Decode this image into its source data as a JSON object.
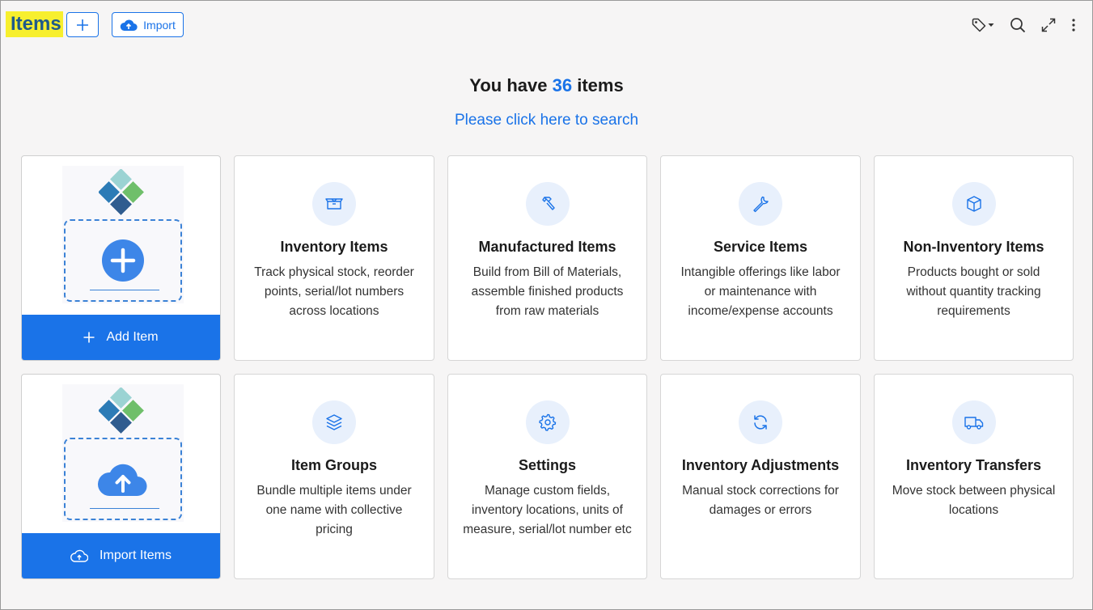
{
  "header": {
    "title": "Items",
    "import_label": "Import"
  },
  "headline": {
    "prefix": "You have",
    "count": "36",
    "suffix": "items"
  },
  "search_link": "Please click here to search",
  "actions": {
    "add_item_label": "Add Item",
    "import_items_label": "Import Items"
  },
  "cards": [
    {
      "title": "Inventory Items",
      "desc": "Track physical stock, reorder points, serial/lot numbers across locations",
      "icon": "box-open-icon"
    },
    {
      "title": "Manufactured Items",
      "desc": "Build from Bill of Materials, assemble finished products from raw materials",
      "icon": "hammer-icon"
    },
    {
      "title": "Service Items",
      "desc": "Intangible offerings like labor or maintenance with income/expense accounts",
      "icon": "wrench-icon"
    },
    {
      "title": "Non-Inventory Items",
      "desc": "Products bought or sold without quantity tracking requirements",
      "icon": "cube-icon"
    },
    {
      "title": "Item Groups",
      "desc": "Bundle multiple items under one name with collective pricing",
      "icon": "layers-icon"
    },
    {
      "title": "Settings",
      "desc": "Manage custom fields, inventory locations, units of measure, serial/lot number etc",
      "icon": "gear-icon"
    },
    {
      "title": "Inventory Adjustments",
      "desc": "Manual stock corrections for damages or errors",
      "icon": "refresh-icon"
    },
    {
      "title": "Inventory Transfers",
      "desc": "Move stock between physical locations",
      "icon": "truck-icon"
    }
  ],
  "colors": {
    "accent": "#1a73e8",
    "title_highlight": "#f7ef2e",
    "title_text": "#1f5a8a",
    "icon_bg": "#e8f0fc"
  }
}
